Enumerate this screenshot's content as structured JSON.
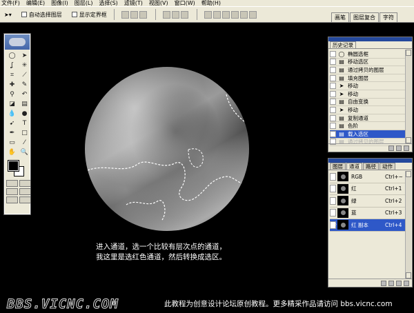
{
  "menu": [
    "文件(F)",
    "编辑(E)",
    "图像(I)",
    "图层(L)",
    "选择(S)",
    "滤镜(T)",
    "视图(V)",
    "窗口(W)",
    "帮助(H)"
  ],
  "options": {
    "auto_select_label": "自动选择图层",
    "show_bounds_label": "显示定界框"
  },
  "palette_well": [
    "画笔",
    "图层复合",
    "字符"
  ],
  "history": {
    "tabs": [
      "历史记录"
    ],
    "items": [
      {
        "label": "椭圆选框"
      },
      {
        "label": "移动选区"
      },
      {
        "label": "通过拷贝的图层"
      },
      {
        "label": "填充图层"
      },
      {
        "label": "移动"
      },
      {
        "label": "移动"
      },
      {
        "label": "自由变换"
      },
      {
        "label": "移动"
      },
      {
        "label": "复制通道"
      },
      {
        "label": "色阶"
      },
      {
        "label": "载入选区"
      },
      {
        "label": "通过拷贝的图层"
      }
    ]
  },
  "channels": {
    "tabs": [
      "图层",
      "通道",
      "路径",
      "动作"
    ],
    "rows": [
      {
        "name": "RGB",
        "shortcut": "Ctrl+~"
      },
      {
        "name": "红",
        "shortcut": "Ctrl+1"
      },
      {
        "name": "绿",
        "shortcut": "Ctrl+2"
      },
      {
        "name": "蓝",
        "shortcut": "Ctrl+3"
      },
      {
        "name": "红 副本",
        "shortcut": "Ctrl+4"
      }
    ]
  },
  "caption": {
    "line1": "进入通道，选一个比较有层次点的通道，",
    "line2": "我这里是选红色通道，然后转换成选区。"
  },
  "footer": {
    "logo": "BBS.VICNC.COM",
    "text": "此教程为创意设计论坛原创教程。更多精采作品请访问 bbs.vicnc.com"
  },
  "colors": {
    "selection": "#2e58c8",
    "panel_bg": "#ece9d8",
    "canvas_bg": "#000000"
  }
}
